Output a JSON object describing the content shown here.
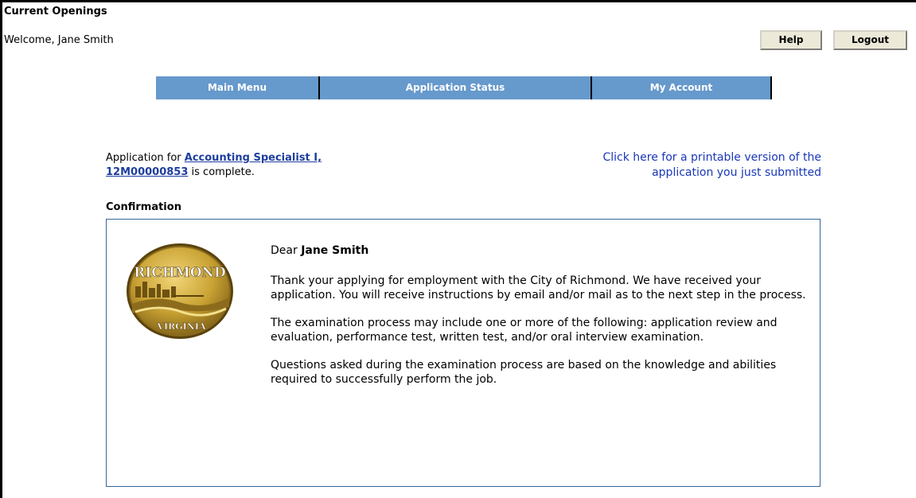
{
  "header": {
    "page_title": "Current Openings",
    "welcome": "Welcome, Jane Smith",
    "help_label": "Help",
    "logout_label": "Logout"
  },
  "nav": {
    "items": [
      {
        "label": "Main Menu"
      },
      {
        "label": "Application Status"
      },
      {
        "label": "My Account"
      }
    ]
  },
  "application": {
    "prefix": "Application for ",
    "job_title": "Accounting Specialist I,",
    "job_number": "12M00000853",
    "suffix": " is complete.",
    "print_link_line1": "Click here for a printable version of the",
    "print_link_line2": "application you just submitted"
  },
  "confirmation": {
    "heading": "Confirmation",
    "seal": {
      "top_text": "RICHMOND",
      "bottom_text": "VIRGINIA"
    },
    "greeting_prefix": "Dear ",
    "recipient": "Jane Smith",
    "paragraph1": "Thank your applying for employment with the City of Richmond. We have received your application. You will receive instructions by email and/or mail as to the next step in the process.",
    "paragraph2": "The examination process may include one or more of the following: application review and evaluation, performance test, written test, and/or oral interview examination.",
    "paragraph3": "Questions asked during the examination process are based on the knowledge and abilities required to successfully perform the job."
  },
  "colors": {
    "nav_bg": "#6699cc",
    "link": "#1e3e9e",
    "box_border": "#33669a",
    "seal_gold": "#c9a233"
  }
}
